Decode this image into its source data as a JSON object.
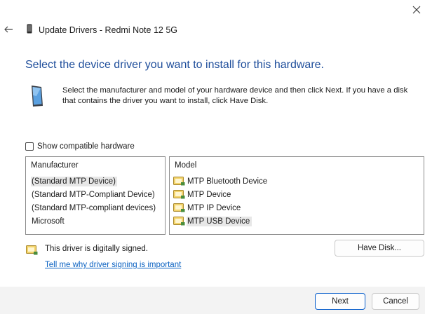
{
  "window": {
    "title": "Update Drivers - Redmi Note 12 5G",
    "back_icon": "back-arrow-icon",
    "close_icon": "close-icon"
  },
  "main": {
    "heading": "Select the device driver you want to install for this hardware.",
    "instructions": "Select the manufacturer and model of your hardware device and then click Next. If you have a disk that contains the driver you want to install, click Have Disk.",
    "show_compatible_label": "Show compatible hardware",
    "show_compatible_checked": false
  },
  "manufacturer_list": {
    "header": "Manufacturer",
    "items": [
      {
        "label": "(Standard MTP Device)",
        "selected": true
      },
      {
        "label": "(Standard MTP-Compliant Device)",
        "selected": false
      },
      {
        "label": "(Standard MTP-compliant devices)",
        "selected": false
      },
      {
        "label": "Microsoft",
        "selected": false
      }
    ]
  },
  "model_list": {
    "header": "Model",
    "items": [
      {
        "label": "MTP Bluetooth Device",
        "selected": false,
        "icon": "signed-driver-icon"
      },
      {
        "label": "MTP Device",
        "selected": false,
        "icon": "signed-driver-icon"
      },
      {
        "label": "MTP IP Device",
        "selected": false,
        "icon": "signed-driver-icon"
      },
      {
        "label": "MTP USB Device",
        "selected": true,
        "icon": "signed-driver-icon"
      }
    ]
  },
  "signing": {
    "status_text": "This driver is digitally signed.",
    "link_text": "Tell me why driver signing is important",
    "icon": "signed-driver-icon"
  },
  "buttons": {
    "have_disk": "Have Disk...",
    "next": "Next",
    "cancel": "Cancel"
  },
  "colors": {
    "heading": "#1f4e9b",
    "link": "#0b62c2",
    "primary_border": "#0a5fcc",
    "footer_bg": "#f3f3f3",
    "selection_bg": "#e7e7e7"
  }
}
